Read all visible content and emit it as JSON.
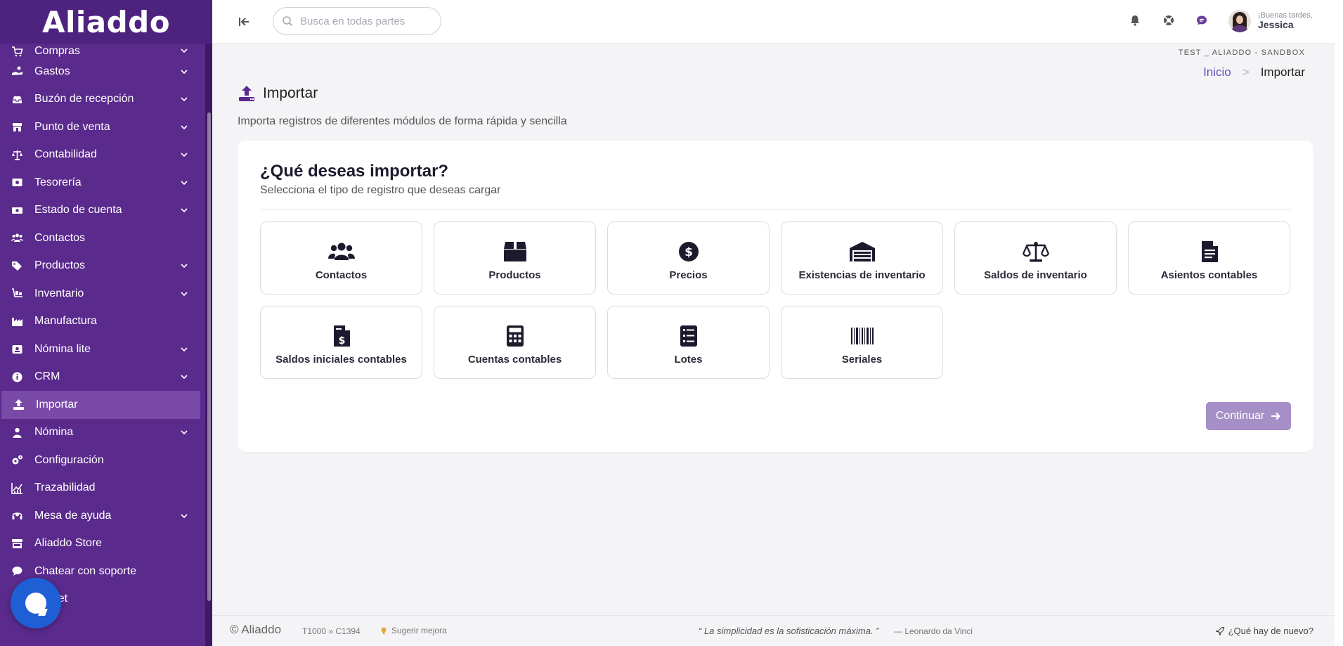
{
  "app": {
    "brand": "Aliaddo"
  },
  "sidebar": {
    "items": [
      {
        "label": "Compras",
        "icon": "cart-icon",
        "chevron": true,
        "partial": true
      },
      {
        "label": "Gastos",
        "icon": "hand-coin-icon",
        "chevron": true
      },
      {
        "label": "Buzón de recepción",
        "icon": "inbox-icon",
        "chevron": true
      },
      {
        "label": "Punto de venta",
        "icon": "store-icon",
        "chevron": true
      },
      {
        "label": "Contabilidad",
        "icon": "scale-icon",
        "chevron": true
      },
      {
        "label": "Tesorería",
        "icon": "vault-icon",
        "chevron": true
      },
      {
        "label": "Estado de cuenta",
        "icon": "money-bill-icon",
        "chevron": true
      },
      {
        "label": "Contactos",
        "icon": "users-icon",
        "chevron": false
      },
      {
        "label": "Productos",
        "icon": "tags-icon",
        "chevron": true
      },
      {
        "label": "Inventario",
        "icon": "dolly-icon",
        "chevron": true
      },
      {
        "label": "Manufactura",
        "icon": "industry-icon",
        "chevron": false
      },
      {
        "label": "Nómina lite",
        "icon": "payroll-icon",
        "chevron": true
      },
      {
        "label": "CRM",
        "icon": "info-icon",
        "chevron": true
      },
      {
        "label": "Importar",
        "icon": "upload-icon",
        "chevron": false,
        "active": true
      },
      {
        "label": "Nómina",
        "icon": "user-icon",
        "chevron": true
      },
      {
        "label": "Configuración",
        "icon": "gears-icon",
        "chevron": false
      },
      {
        "label": "Trazabilidad",
        "icon": "chart-line-icon",
        "chevron": false
      },
      {
        "label": "Mesa de ayuda",
        "icon": "headset-icon",
        "chevron": true
      },
      {
        "label": "Aliaddo Store",
        "icon": "shop-icon",
        "chevron": false
      },
      {
        "label": "Chatear con soporte",
        "icon": "chat-icon",
        "chevron": false
      },
      {
        "label": "r ticket",
        "icon": "ticket-icon",
        "chevron": false
      }
    ]
  },
  "header": {
    "search_placeholder": "Busca en todas partes",
    "greeting": "¡Buenas tardes,",
    "user_name": "Jessica"
  },
  "company": "TEST _ ALIADDO - SANDBOX",
  "breadcrumb": {
    "home": "Inicio",
    "separator": ">",
    "current": "Importar"
  },
  "page": {
    "title": "Importar",
    "description": "Importa registros de diferentes módulos de forma rápida y sencilla"
  },
  "card": {
    "heading": "¿Qué deseas importar?",
    "subheading": "Selecciona el tipo de registro que deseas cargar",
    "options": [
      {
        "label": "Contactos",
        "icon": "users-icon"
      },
      {
        "label": "Productos",
        "icon": "box-icon"
      },
      {
        "label": "Precios",
        "icon": "dollar-circle-icon"
      },
      {
        "label": "Existencias de inventario",
        "icon": "warehouse-icon"
      },
      {
        "label": "Saldos de inventario",
        "icon": "scale-icon"
      },
      {
        "label": "Asientos contables",
        "icon": "document-icon"
      },
      {
        "label": "Saldos iniciales contables",
        "icon": "invoice-dollar-icon"
      },
      {
        "label": "Cuentas contables",
        "icon": "calculator-icon"
      },
      {
        "label": "Lotes",
        "icon": "checklist-icon"
      },
      {
        "label": "Seriales",
        "icon": "barcode-icon"
      }
    ],
    "continue_label": "Continuar"
  },
  "footer": {
    "brand": "© Aliaddo",
    "code": "T1000 » C1394",
    "suggest": "Sugerir mejora",
    "quote": "“ La simplicidad es la sofisticación máxima. ”",
    "author": "— Leonardo da Vinci",
    "news": "¿Qué hay de nuevo?"
  },
  "colors": {
    "sidebar_bg": "#5a2a8c",
    "sidebar_active": "#7a4aa8",
    "accent": "#6a4bbd",
    "continue_button": "#a58fc6",
    "chat_bubble": "#1e5fd6"
  }
}
